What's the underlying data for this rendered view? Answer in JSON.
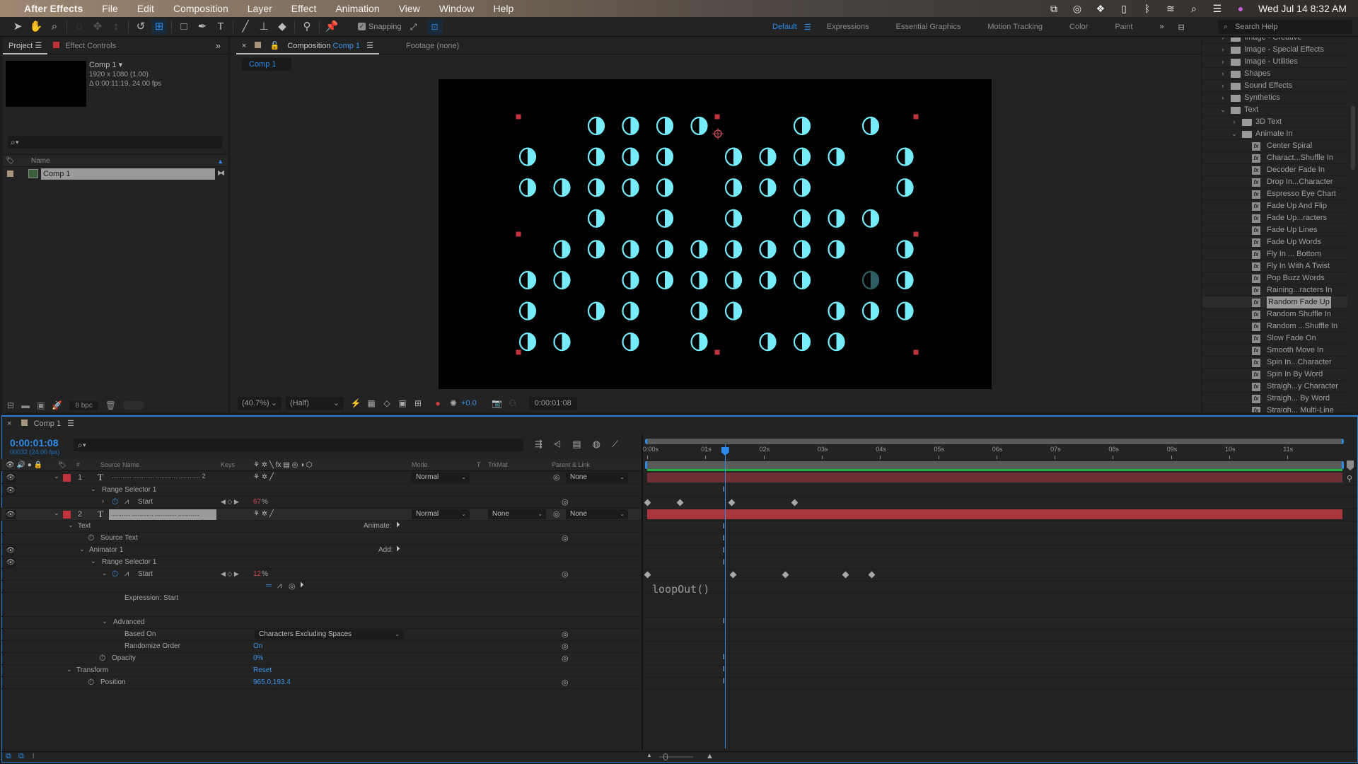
{
  "menubar": {
    "apple": "",
    "app_name": "After Effects",
    "items": [
      "File",
      "Edit",
      "Composition",
      "Layer",
      "Effect",
      "Animation",
      "View",
      "Window",
      "Help"
    ],
    "status_icons": [
      "screen-mirror-icon",
      "creative-cloud-icon",
      "dropbox-icon",
      "battery-icon",
      "bluetooth-icon",
      "wifi-icon",
      "spotlight-search-icon",
      "control-center-icon",
      "siri-icon"
    ],
    "datetime": "Wed Jul 14  8:32 AM"
  },
  "toolbar": {
    "snapping_label": "Snapping",
    "snapping_checked": true,
    "workspaces": [
      "Default",
      "Expressions",
      "Essential Graphics",
      "Motion Tracking",
      "Color",
      "Paint"
    ],
    "active_workspace": "Default",
    "search_help_placeholder": "Search Help"
  },
  "project_panel": {
    "tabs": {
      "project": "Project",
      "effect_controls": "Effect Controls"
    },
    "comp_name": "Comp 1 ▾",
    "comp_resolution": "1920 x 1080 (1.00)",
    "comp_duration": "Δ 0:00:11:19, 24.00 fps",
    "search_placeholder": "",
    "column_name": "Name",
    "items": [
      {
        "name": "Comp 1"
      }
    ],
    "bpc": "8 bpc"
  },
  "composition_panel": {
    "tab_prefix": "Composition",
    "tab_comp": "Comp 1",
    "footage_tab": "Footage (none)",
    "comp_subtab": "Comp 1",
    "zoom": "(40.7%)",
    "resolution": "(Half)",
    "exposure": "+0.0",
    "timecode": "0:00:01:08",
    "grid_rows": [
      [
        0,
        0,
        1,
        1,
        1,
        1,
        0,
        0,
        1,
        0,
        1,
        0
      ],
      [
        1,
        0,
        1,
        1,
        1,
        0,
        1,
        1,
        1,
        1,
        0,
        1
      ],
      [
        1,
        1,
        1,
        1,
        1,
        0,
        1,
        1,
        1,
        0,
        0,
        1
      ],
      [
        0,
        0,
        1,
        0,
        1,
        0,
        1,
        0,
        1,
        1,
        1,
        0
      ],
      [
        0,
        1,
        1,
        1,
        1,
        1,
        1,
        1,
        1,
        1,
        0,
        1
      ],
      [
        1,
        1,
        0,
        1,
        1,
        1,
        1,
        1,
        1,
        0,
        2,
        1
      ],
      [
        1,
        0,
        1,
        1,
        0,
        1,
        1,
        0,
        0,
        1,
        1,
        1
      ],
      [
        1,
        1,
        0,
        1,
        0,
        1,
        0,
        1,
        1,
        1,
        0,
        0
      ]
    ],
    "glyph_color": "#76ebfa",
    "handle_color": "#c0333a"
  },
  "effects_panel": {
    "items": [
      {
        "label": "Image - Creative",
        "level": 0,
        "type": "folder",
        "open": false
      },
      {
        "label": "Image - Special Effects",
        "level": 0,
        "type": "folder",
        "open": false
      },
      {
        "label": "Image - Utilities",
        "level": 0,
        "type": "folder",
        "open": false
      },
      {
        "label": "Shapes",
        "level": 0,
        "type": "folder",
        "open": false
      },
      {
        "label": "Sound Effects",
        "level": 0,
        "type": "folder",
        "open": false
      },
      {
        "label": "Synthetics",
        "level": 0,
        "type": "folder",
        "open": false
      },
      {
        "label": "Text",
        "level": 0,
        "type": "folder",
        "open": true
      },
      {
        "label": "3D Text",
        "level": 1,
        "type": "folder",
        "open": false
      },
      {
        "label": "Animate In",
        "level": 1,
        "type": "folder",
        "open": true
      },
      {
        "label": "Center Spiral",
        "level": 2,
        "type": "preset"
      },
      {
        "label": "Charact...Shuffle In",
        "level": 2,
        "type": "preset"
      },
      {
        "label": "Decoder Fade In",
        "level": 2,
        "type": "preset"
      },
      {
        "label": "Drop In...Character",
        "level": 2,
        "type": "preset"
      },
      {
        "label": "Espresso Eye Chart",
        "level": 2,
        "type": "preset"
      },
      {
        "label": "Fade Up And Flip",
        "level": 2,
        "type": "preset"
      },
      {
        "label": "Fade Up...racters",
        "level": 2,
        "type": "preset"
      },
      {
        "label": "Fade Up Lines",
        "level": 2,
        "type": "preset"
      },
      {
        "label": "Fade Up Words",
        "level": 2,
        "type": "preset"
      },
      {
        "label": "Fly In ... Bottom",
        "level": 2,
        "type": "preset"
      },
      {
        "label": "Fly In With A Twist",
        "level": 2,
        "type": "preset"
      },
      {
        "label": "Pop Buzz Words",
        "level": 2,
        "type": "preset"
      },
      {
        "label": "Raining...racters In",
        "level": 2,
        "type": "preset"
      },
      {
        "label": "Random Fade Up",
        "level": 2,
        "type": "preset",
        "selected": true
      },
      {
        "label": "Random Shuffle In",
        "level": 2,
        "type": "preset"
      },
      {
        "label": "Random ...Shuffle In",
        "level": 2,
        "type": "preset"
      },
      {
        "label": "Slow Fade On",
        "level": 2,
        "type": "preset"
      },
      {
        "label": "Smooth Move In",
        "level": 2,
        "type": "preset"
      },
      {
        "label": "Spin In...Character",
        "level": 2,
        "type": "preset"
      },
      {
        "label": "Spin In By Word",
        "level": 2,
        "type": "preset"
      },
      {
        "label": "Straigh...y Character",
        "level": 2,
        "type": "preset"
      },
      {
        "label": "Straigh... By Word",
        "level": 2,
        "type": "preset"
      },
      {
        "label": "Straigh... Multi-Line",
        "level": 2,
        "type": "preset"
      }
    ]
  },
  "timeline": {
    "tab": "Comp 1",
    "current_time": "0:00:01:08",
    "frame_info": "00032 (24.00 fps)",
    "columns": {
      "num": "#",
      "source_name": "Source Name",
      "keys": "Keys",
      "mode": "Mode",
      "t": "T",
      "trkmat": "TrkMat",
      "parent": "Parent & Link"
    },
    "ruler_ticks": [
      "0:00s",
      "01s",
      "02s",
      "03s",
      "04s",
      "05s",
      "06s",
      "07s",
      "08s",
      "09s",
      "10s",
      "11s"
    ],
    "duration_seconds": 11.79,
    "playhead_seconds": 1.333,
    "layers": [
      {
        "num": "1",
        "name": "........... ............ ............ ............ 2",
        "mode": "Normal",
        "trkmat": "",
        "parent": "None"
      },
      {
        "num": "2",
        "name": "........... ............ ............ ............",
        "mode": "Normal",
        "trkmat": "None",
        "parent": "None"
      }
    ],
    "rows": {
      "l1_range_selector": "Range Selector 1",
      "l1_start": "Start",
      "l1_start_value": "67",
      "pct": "%",
      "text": "Text",
      "animate_label": "Animate:",
      "source_text": "Source Text",
      "animator": "Animator 1",
      "add_label": "Add:",
      "l2_range_selector": "Range Selector 1",
      "l2_start": "Start",
      "l2_start_value": "12",
      "expression_label": "Expression: Start",
      "expression_code": "loopOut()",
      "advanced": "Advanced",
      "based_on": "Based On",
      "based_on_value": "Characters Excluding Spaces",
      "randomize": "Randomize Order",
      "randomize_value": "On",
      "opacity": "Opacity",
      "opacity_value": "0%",
      "transform": "Transform",
      "transform_reset": "Reset",
      "position": "Position",
      "position_value": "965.0,193.4"
    },
    "keyframes_l1_seconds": [
      0.0,
      0.56,
      1.45,
      2.53
    ],
    "keyframes_l2_seconds": [
      0.0,
      1.47,
      2.37,
      3.4,
      3.85
    ]
  }
}
